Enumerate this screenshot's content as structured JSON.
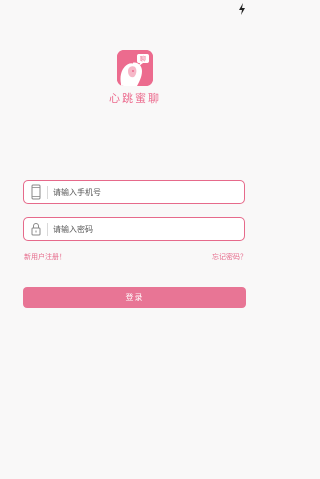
{
  "status_bar": {
    "icon": "charging-bolt-icon"
  },
  "app": {
    "name": "心跳蜜聊",
    "logo_icon": "girl-with-speech-bubble-logo",
    "logo_bubble_text": "聊",
    "accent_color": "#ec6b8e"
  },
  "form": {
    "phone": {
      "placeholder": "请输入手机号",
      "value": "",
      "icon": "phone-icon"
    },
    "password": {
      "placeholder": "请输入密码",
      "value": "",
      "icon": "lock-icon"
    }
  },
  "links": {
    "register": "新用户注册！",
    "forgot_password": "忘记密码？"
  },
  "login_button": {
    "label": "登录"
  }
}
